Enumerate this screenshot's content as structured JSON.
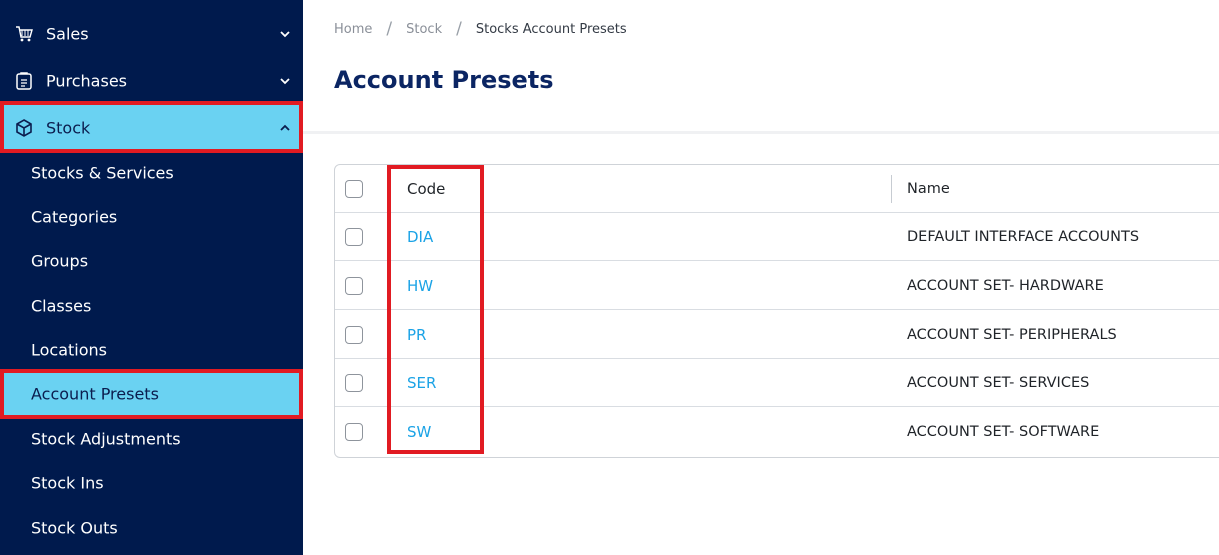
{
  "sidebar": {
    "sales": {
      "label": "Sales",
      "icon": "shopping-cart-icon"
    },
    "purchases": {
      "label": "Purchases",
      "icon": "clipboard-icon"
    },
    "stock": {
      "label": "Stock",
      "icon": "box-icon"
    },
    "items": [
      "Stocks & Services",
      "Categories",
      "Groups",
      "Classes",
      "Locations",
      "Account Presets",
      "Stock Adjustments",
      "Stock Ins",
      "Stock Outs"
    ],
    "active_item": "Account Presets"
  },
  "breadcrumb": {
    "home": "Home",
    "stock": "Stock",
    "current": "Stocks Account Presets",
    "separator": "/"
  },
  "page": {
    "title": "Account Presets"
  },
  "table": {
    "headers": {
      "code": "Code",
      "name": "Name"
    },
    "rows": [
      {
        "code": "DIA",
        "name": "DEFAULT INTERFACE ACCOUNTS"
      },
      {
        "code": "HW",
        "name": "ACCOUNT SET- HARDWARE"
      },
      {
        "code": "PR",
        "name": "ACCOUNT SET- PERIPHERALS"
      },
      {
        "code": "SER",
        "name": "ACCOUNT SET- SERVICES"
      },
      {
        "code": "SW",
        "name": "ACCOUNT SET- SOFTWARE"
      }
    ]
  },
  "colors": {
    "sidebar_bg": "#001a4d",
    "active_bg": "#6ad2f2",
    "title": "#0b2563",
    "link": "#1ba3e6",
    "highlight": "#e11b22"
  }
}
